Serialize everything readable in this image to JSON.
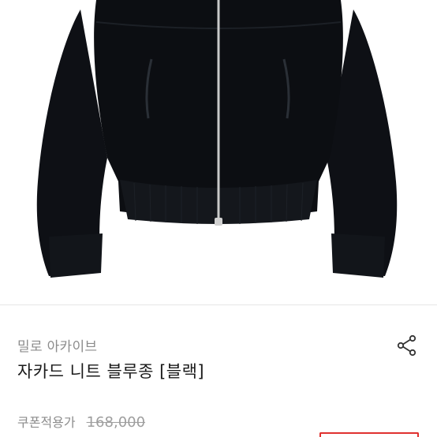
{
  "product": {
    "brand": "밀로 아카이브",
    "title": "자카드 니트 블루종 [블랙]",
    "price_label": "쿠폰적용가",
    "original_price": "168,000"
  },
  "icons": {
    "share": "share-icon"
  },
  "colors": {
    "garment": "#0d0f13",
    "zipper": "#c9c9c9",
    "accent": "#e0312f"
  }
}
